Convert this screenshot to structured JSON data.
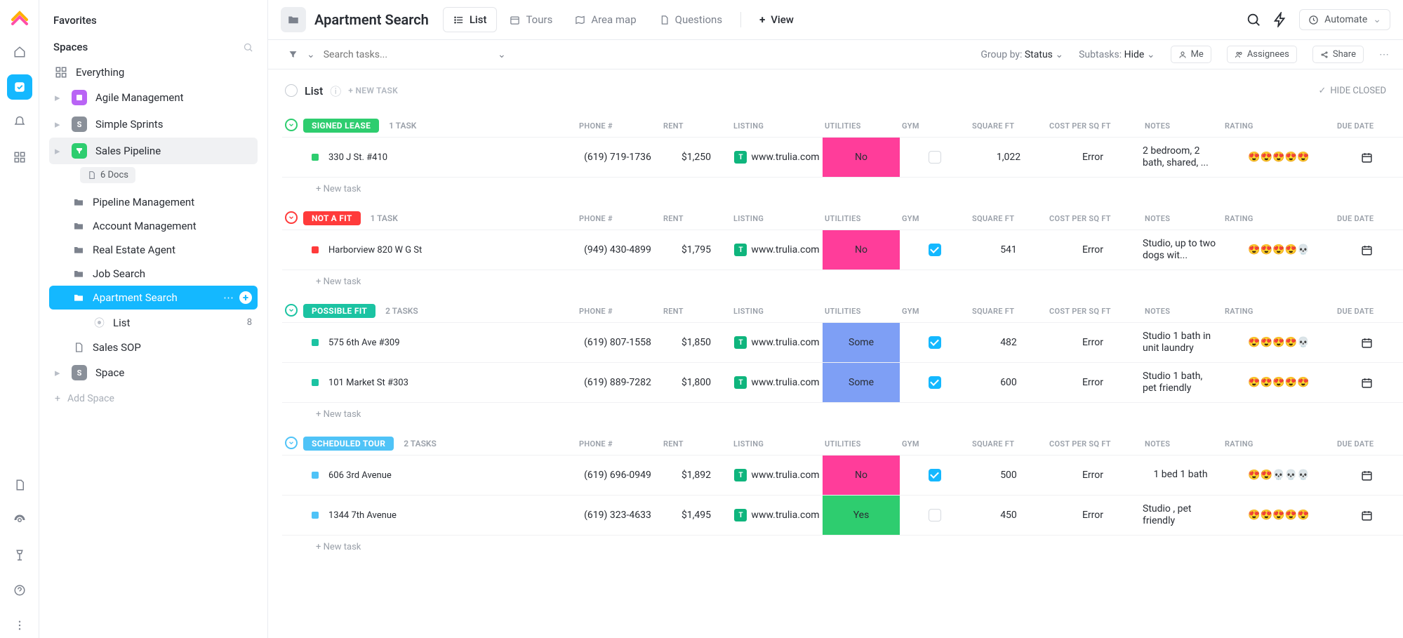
{
  "sidebar": {
    "favorites": "Favorites",
    "spaces": "Spaces",
    "everything": "Everything",
    "items": [
      {
        "label": "Agile Management",
        "color": "#b964f5",
        "letter": ""
      },
      {
        "label": "Simple Sprints",
        "color": "#8a9099",
        "letter": "S"
      },
      {
        "label": "Sales Pipeline",
        "color": "#2ecd6f",
        "letter": ""
      }
    ],
    "docs": "6 Docs",
    "folders": [
      "Pipeline Management",
      "Account Management",
      "Real Estate Agent",
      "Job Search"
    ],
    "active": "Apartment Search",
    "listChild": "List",
    "listCount": "8",
    "salesSop": "Sales SOP",
    "space": "Space",
    "addSpace": "Add Space"
  },
  "header": {
    "title": "Apartment Search",
    "tabs": [
      "List",
      "Tours",
      "Area map",
      "Questions"
    ],
    "addView": "View",
    "automate": "Automate"
  },
  "toolbar": {
    "searchPlaceholder": "Search tasks...",
    "groupBy": "Group by:",
    "groupByVal": "Status",
    "subtasks": "Subtasks:",
    "subtasksVal": "Hide",
    "me": "Me",
    "assignees": "Assignees",
    "share": "Share"
  },
  "list": {
    "title": "List",
    "newTask": "+ NEW TASK",
    "hideClosed": "HIDE CLOSED",
    "addTask": "+ New task"
  },
  "columns": [
    "PHONE #",
    "RENT",
    "LISTING",
    "UTILITIES",
    "GYM",
    "SQUARE FT",
    "COST PER SQ FT",
    "NOTES",
    "RATING",
    "DUE DATE"
  ],
  "groups": [
    {
      "status": "SIGNED LEASE",
      "color": "#2ecd6f",
      "count": "1 TASK",
      "rows": [
        {
          "name": "330 J St. #410",
          "dot": "#2ecd6f",
          "phone": "(619) 719-1736",
          "rent": "$1,250",
          "listing": "www.trulia.com",
          "util": "No",
          "utilClass": "util-no",
          "gym": false,
          "sqft": "1,022",
          "cost": "Error",
          "notes": "2 bedroom, 2 bath, shared, ...",
          "rating": "😍😍😍😍😍"
        }
      ]
    },
    {
      "status": "NOT A FIT",
      "color": "#ff3b3b",
      "count": "1 TASK",
      "rows": [
        {
          "name": "Harborview 820 W G St",
          "dot": "#ff3b3b",
          "phone": "(949) 430-4899",
          "rent": "$1,795",
          "listing": "www.trulia.com",
          "util": "No",
          "utilClass": "util-no",
          "gym": true,
          "sqft": "541",
          "cost": "Error",
          "notes": "Studio, up to two dogs wit...",
          "rating": "😍😍😍😍💀"
        }
      ]
    },
    {
      "status": "POSSIBLE FIT",
      "color": "#1bc3a2",
      "count": "2 TASKS",
      "rows": [
        {
          "name": "575 6th Ave #309",
          "dot": "#1bc3a2",
          "phone": "(619) 807-1558",
          "rent": "$1,850",
          "listing": "www.trulia.com",
          "util": "Some",
          "utilClass": "util-some",
          "gym": true,
          "sqft": "482",
          "cost": "Error",
          "notes": "Studio 1 bath in unit laundry",
          "rating": "😍😍😍😍💀"
        },
        {
          "name": "101 Market St #303",
          "dot": "#1bc3a2",
          "phone": "(619) 889-7282",
          "rent": "$1,800",
          "listing": "www.trulia.com",
          "util": "Some",
          "utilClass": "util-some",
          "gym": true,
          "sqft": "600",
          "cost": "Error",
          "notes": "Studio 1 bath, pet friendly",
          "rating": "😍😍😍😍😍"
        }
      ]
    },
    {
      "status": "SCHEDULED TOUR",
      "color": "#4fc3f7",
      "count": "2 TASKS",
      "rows": [
        {
          "name": "606 3rd Avenue",
          "dot": "#4fc3f7",
          "phone": "(619) 696-0949",
          "rent": "$1,892",
          "listing": "www.trulia.com",
          "util": "No",
          "utilClass": "util-no",
          "gym": true,
          "sqft": "500",
          "cost": "Error",
          "notes": "1 bed 1 bath",
          "rating": "😍😍💀💀💀"
        },
        {
          "name": "1344 7th Avenue",
          "dot": "#4fc3f7",
          "phone": "(619) 323-4633",
          "rent": "$1,495",
          "listing": "www.trulia.com",
          "util": "Yes",
          "utilClass": "util-yes",
          "gym": false,
          "sqft": "450",
          "cost": "Error",
          "notes": "Studio , pet friendly",
          "rating": "😍😍😍😍😍"
        }
      ]
    }
  ]
}
